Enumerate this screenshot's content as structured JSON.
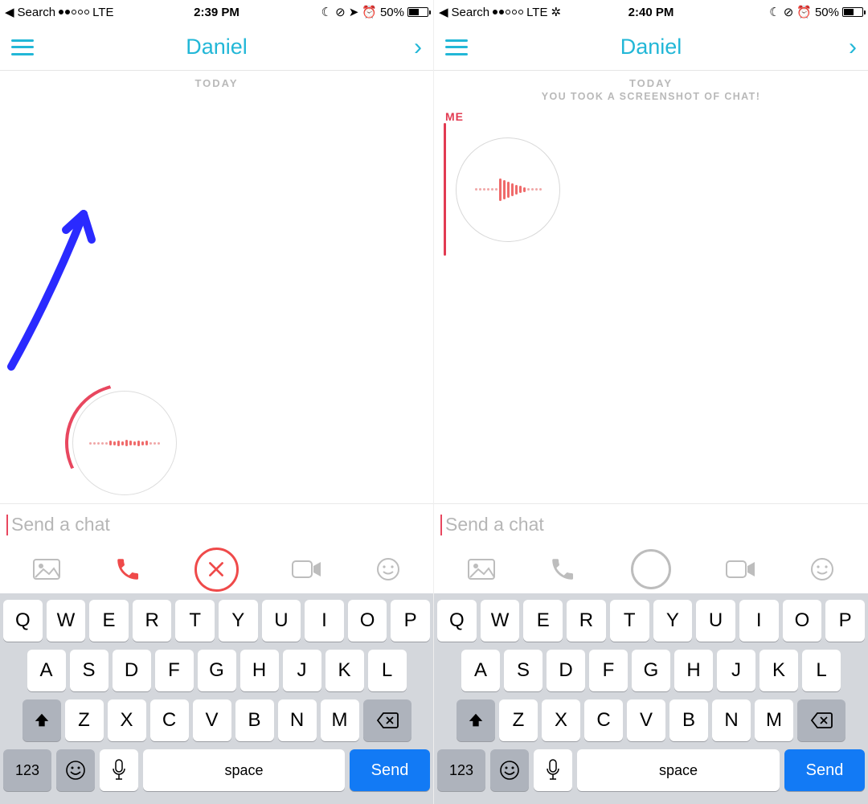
{
  "left": {
    "status": {
      "search": "Search",
      "signal_filled": 2,
      "signal_total": 5,
      "carrier": "LTE",
      "time": "2:39 PM",
      "battery": "50%"
    },
    "nav": {
      "title": "Daniel"
    },
    "chat": {
      "date": "TODAY"
    },
    "input": {
      "placeholder": "Send a chat"
    },
    "keyboard": {
      "row1": [
        "Q",
        "W",
        "E",
        "R",
        "T",
        "Y",
        "U",
        "I",
        "O",
        "P"
      ],
      "row2": [
        "A",
        "S",
        "D",
        "F",
        "G",
        "H",
        "J",
        "K",
        "L"
      ],
      "row3": [
        "Z",
        "X",
        "C",
        "V",
        "B",
        "N",
        "M"
      ],
      "numkey": "123",
      "space": "space",
      "send": "Send"
    }
  },
  "right": {
    "status": {
      "search": "Search",
      "signal_filled": 2,
      "signal_total": 5,
      "carrier": "LTE",
      "time": "2:40 PM",
      "battery": "50%"
    },
    "nav": {
      "title": "Daniel"
    },
    "chat": {
      "date": "TODAY",
      "system": "YOU TOOK A SCREENSHOT OF CHAT!",
      "me": "ME"
    },
    "input": {
      "placeholder": "Send a chat"
    },
    "keyboard": {
      "row1": [
        "Q",
        "W",
        "E",
        "R",
        "T",
        "Y",
        "U",
        "I",
        "O",
        "P"
      ],
      "row2": [
        "A",
        "S",
        "D",
        "F",
        "G",
        "H",
        "J",
        "K",
        "L"
      ],
      "row3": [
        "Z",
        "X",
        "C",
        "V",
        "B",
        "N",
        "M"
      ],
      "numkey": "123",
      "space": "space",
      "send": "Send"
    }
  }
}
